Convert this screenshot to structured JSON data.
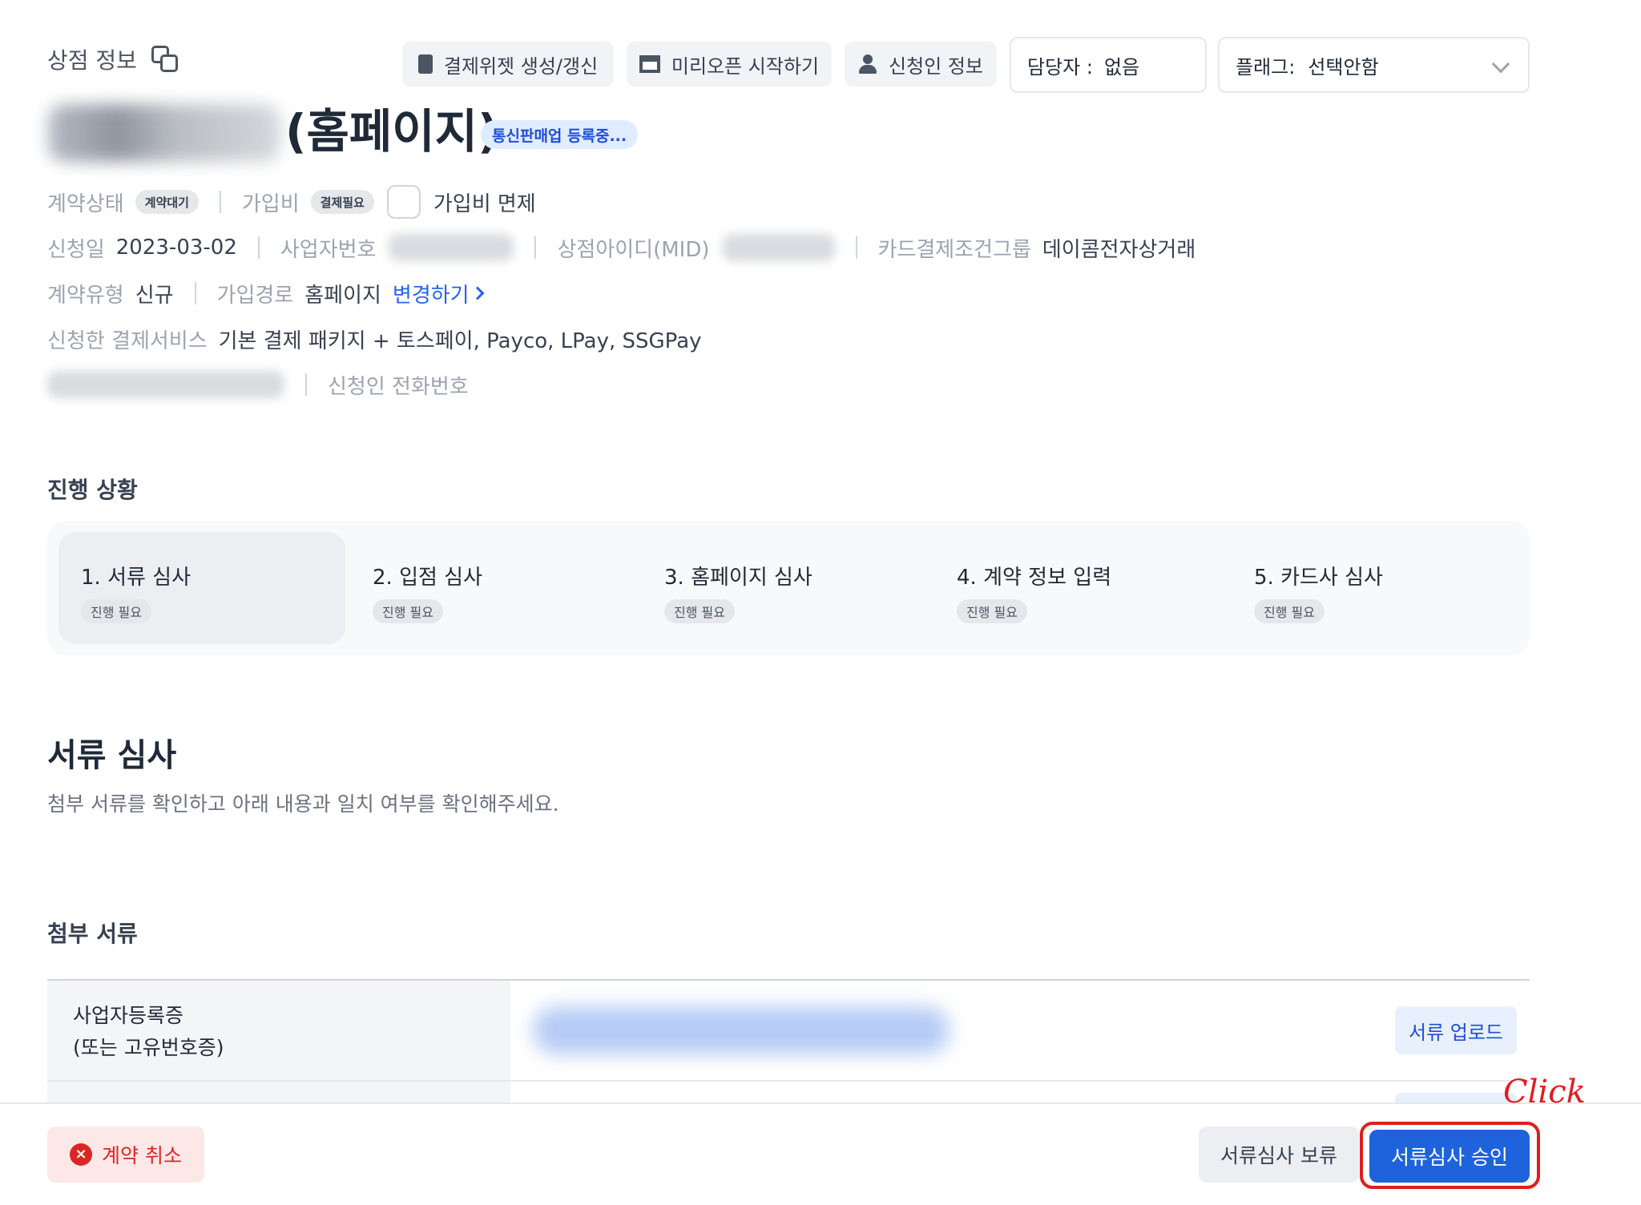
{
  "header": {
    "section_title": "상점 정보",
    "buttons": [
      {
        "label": "결제위젯 생성/갱신",
        "icon": "book-icon"
      },
      {
        "label": "미리오픈 시작하기",
        "icon": "store-icon"
      },
      {
        "label": "신청인 정보",
        "icon": "user-icon"
      }
    ],
    "assignee": {
      "label": "담당자 :",
      "value": "없음"
    },
    "flag": {
      "label": "플래그:",
      "value": "선택안함"
    }
  },
  "store": {
    "name_suffix": "(홈페이지)",
    "badge": "통신판매업 등록중..."
  },
  "info": {
    "contract_status_label": "계약상태",
    "contract_status_value": "계약대기",
    "signup_fee_label": "가입비",
    "signup_fee_value": "결제필요",
    "signup_fee_waive_label": "가입비 면제",
    "apply_date_label": "신청일",
    "apply_date_value": "2023-03-02",
    "business_no_label": "사업자번호",
    "mid_label": "상점아이디(MID)",
    "card_group_label": "카드결제조건그룹",
    "card_group_value": "데이콤전자상거래",
    "contract_type_label": "계약유형",
    "contract_type_value": "신규",
    "signup_path_label": "가입경로",
    "signup_path_value": "홈페이지",
    "change_link": "변경하기",
    "services_label": "신청한 결제서비스",
    "services_value": "기본 결제 패키지 + 토스페이, Payco, LPay, SSGPay",
    "phone_label": "신청인 전화번호"
  },
  "progress": {
    "title": "진행 상황",
    "steps": [
      {
        "title": "1. 서류 심사",
        "status": "진행 필요"
      },
      {
        "title": "2. 입점 심사",
        "status": "진행 필요"
      },
      {
        "title": "3. 홈페이지 심사",
        "status": "진행 필요"
      },
      {
        "title": "4. 계약 정보 입력",
        "status": "진행 필요"
      },
      {
        "title": "5. 카드사 심사",
        "status": "진행 필요"
      }
    ]
  },
  "review": {
    "title": "서류 심사",
    "description": "첨부 서류를 확인하고 아래 내용과 일치 여부를 확인해주세요.",
    "attachments_title": "첨부 서류",
    "documents": [
      {
        "name_line1": "사업자등록증",
        "name_line2": "(또는 고유번호증)",
        "upload_label": "서류 업로드"
      }
    ]
  },
  "footer": {
    "cancel_label": "계약 취소",
    "hold_label": "서류심사 보류",
    "approve_label": "서류심사 승인"
  },
  "annotation": {
    "note": "Click",
    "color": "#e11d1d"
  },
  "colors": {
    "primary": "#1e63db",
    "danger": "#dc2626",
    "link": "#2563eb"
  }
}
